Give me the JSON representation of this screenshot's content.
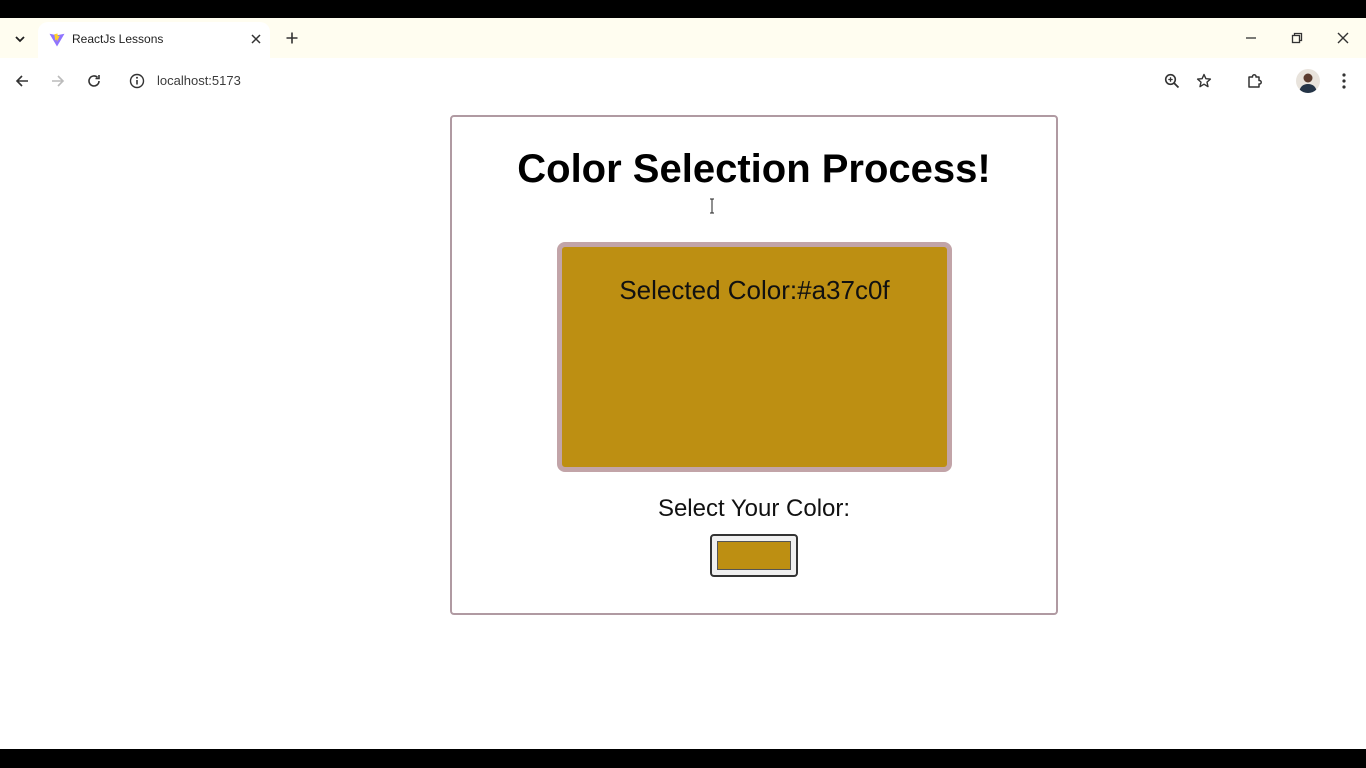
{
  "browser": {
    "tab": {
      "title": "ReactJs Lessons"
    },
    "address": {
      "url": "localhost:5173"
    }
  },
  "page": {
    "title": "Color Selection Process!",
    "selected_color_label": "Selected Color:#a37c0f",
    "select_label": "Select Your Color:"
  },
  "colors": {
    "swatch": "#bd8f12",
    "swatch_border": "#c2a4a8",
    "card_border": "#b09aa2",
    "tabstrip_bg": "#fffdf0"
  },
  "icons": {
    "tab_list": "chevron-down-icon",
    "favicon": "vite-logo-icon",
    "tab_close": "close-icon",
    "new_tab": "plus-icon",
    "back": "arrow-left-icon",
    "forward": "arrow-right-icon",
    "reload": "reload-icon",
    "site_info": "info-icon",
    "zoom": "zoom-icon",
    "bookmark": "star-icon",
    "extensions": "puzzle-icon",
    "menu": "kebab-menu-icon"
  }
}
